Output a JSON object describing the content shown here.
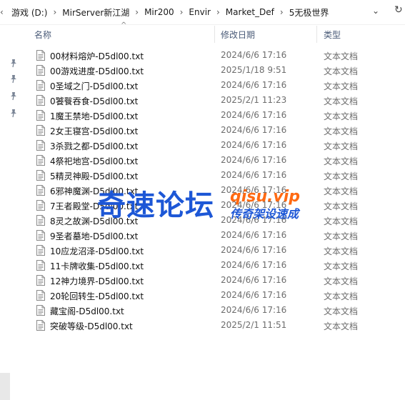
{
  "breadcrumb": [
    "游戏 (D:)",
    "MirServer新江湖",
    "Mir200",
    "Envir",
    "Market_Def",
    "5无极世界"
  ],
  "columns": {
    "name": "名称",
    "date": "修改日期",
    "type": "类型"
  },
  "files": [
    {
      "name": "00材料熔炉-D5dl00.txt",
      "date": "2024/6/6 17:16",
      "type": "文本文档"
    },
    {
      "name": "00游戏进度-D5dl00.txt",
      "date": "2025/1/18 9:51",
      "type": "文本文档"
    },
    {
      "name": "0圣域之门-D5dl00.txt",
      "date": "2024/6/6 17:16",
      "type": "文本文档"
    },
    {
      "name": "0饕餮吞食-D5dl00.txt",
      "date": "2025/2/1 11:23",
      "type": "文本文档"
    },
    {
      "name": "1魔王禁地-D5dl00.txt",
      "date": "2024/6/6 17:16",
      "type": "文本文档"
    },
    {
      "name": "2女王寝宫-D5dl00.txt",
      "date": "2024/6/6 17:16",
      "type": "文本文档"
    },
    {
      "name": "3杀戮之都-D5dl00.txt",
      "date": "2024/6/6 17:16",
      "type": "文本文档"
    },
    {
      "name": "4祭祀地宫-D5dl00.txt",
      "date": "2024/6/6 17:16",
      "type": "文本文档"
    },
    {
      "name": "5精灵神殿-D5dl00.txt",
      "date": "2024/6/6 17:16",
      "type": "文本文档"
    },
    {
      "name": "6邪神魔渊-D5dl00.txt",
      "date": "2024/6/6 17:16",
      "type": "文本文档"
    },
    {
      "name": "7王者殿堂-D5dl00.txt",
      "date": "2024/6/6 17:16",
      "type": "文本文档"
    },
    {
      "name": "8灵之故渊-D5dl00.txt",
      "date": "2024/6/6 17:16",
      "type": "文本文档"
    },
    {
      "name": "9圣者墓地-D5dl00.txt",
      "date": "2024/6/6 17:16",
      "type": "文本文档"
    },
    {
      "name": "10应龙沼泽-D5dl00.txt",
      "date": "2024/6/6 17:16",
      "type": "文本文档"
    },
    {
      "name": "11卡牌收集-D5dl00.txt",
      "date": "2024/6/6 17:16",
      "type": "文本文档"
    },
    {
      "name": "12神力境界-D5dl00.txt",
      "date": "2024/6/6 17:16",
      "type": "文本文档"
    },
    {
      "name": "20轮回转生-D5dl00.txt",
      "date": "2024/6/6 17:16",
      "type": "文本文档"
    },
    {
      "name": "藏宝阁-D5dl00.txt",
      "date": "2024/6/6 17:16",
      "type": "文本文档"
    },
    {
      "name": "突破等级-D5dl00.txt",
      "date": "2025/2/1 11:51",
      "type": "文本文档"
    }
  ],
  "watermark": {
    "title": "奇速论坛",
    "domain": "qisu.vip",
    "subtitle": "传奇架设速成"
  },
  "icons": {
    "pin": "pin-icon",
    "file": "text-file-icon",
    "sort": "sort-up-icon",
    "dropdown": "chevron-down-icon",
    "refresh": "refresh-icon",
    "nav": "chevron-left-icon"
  }
}
